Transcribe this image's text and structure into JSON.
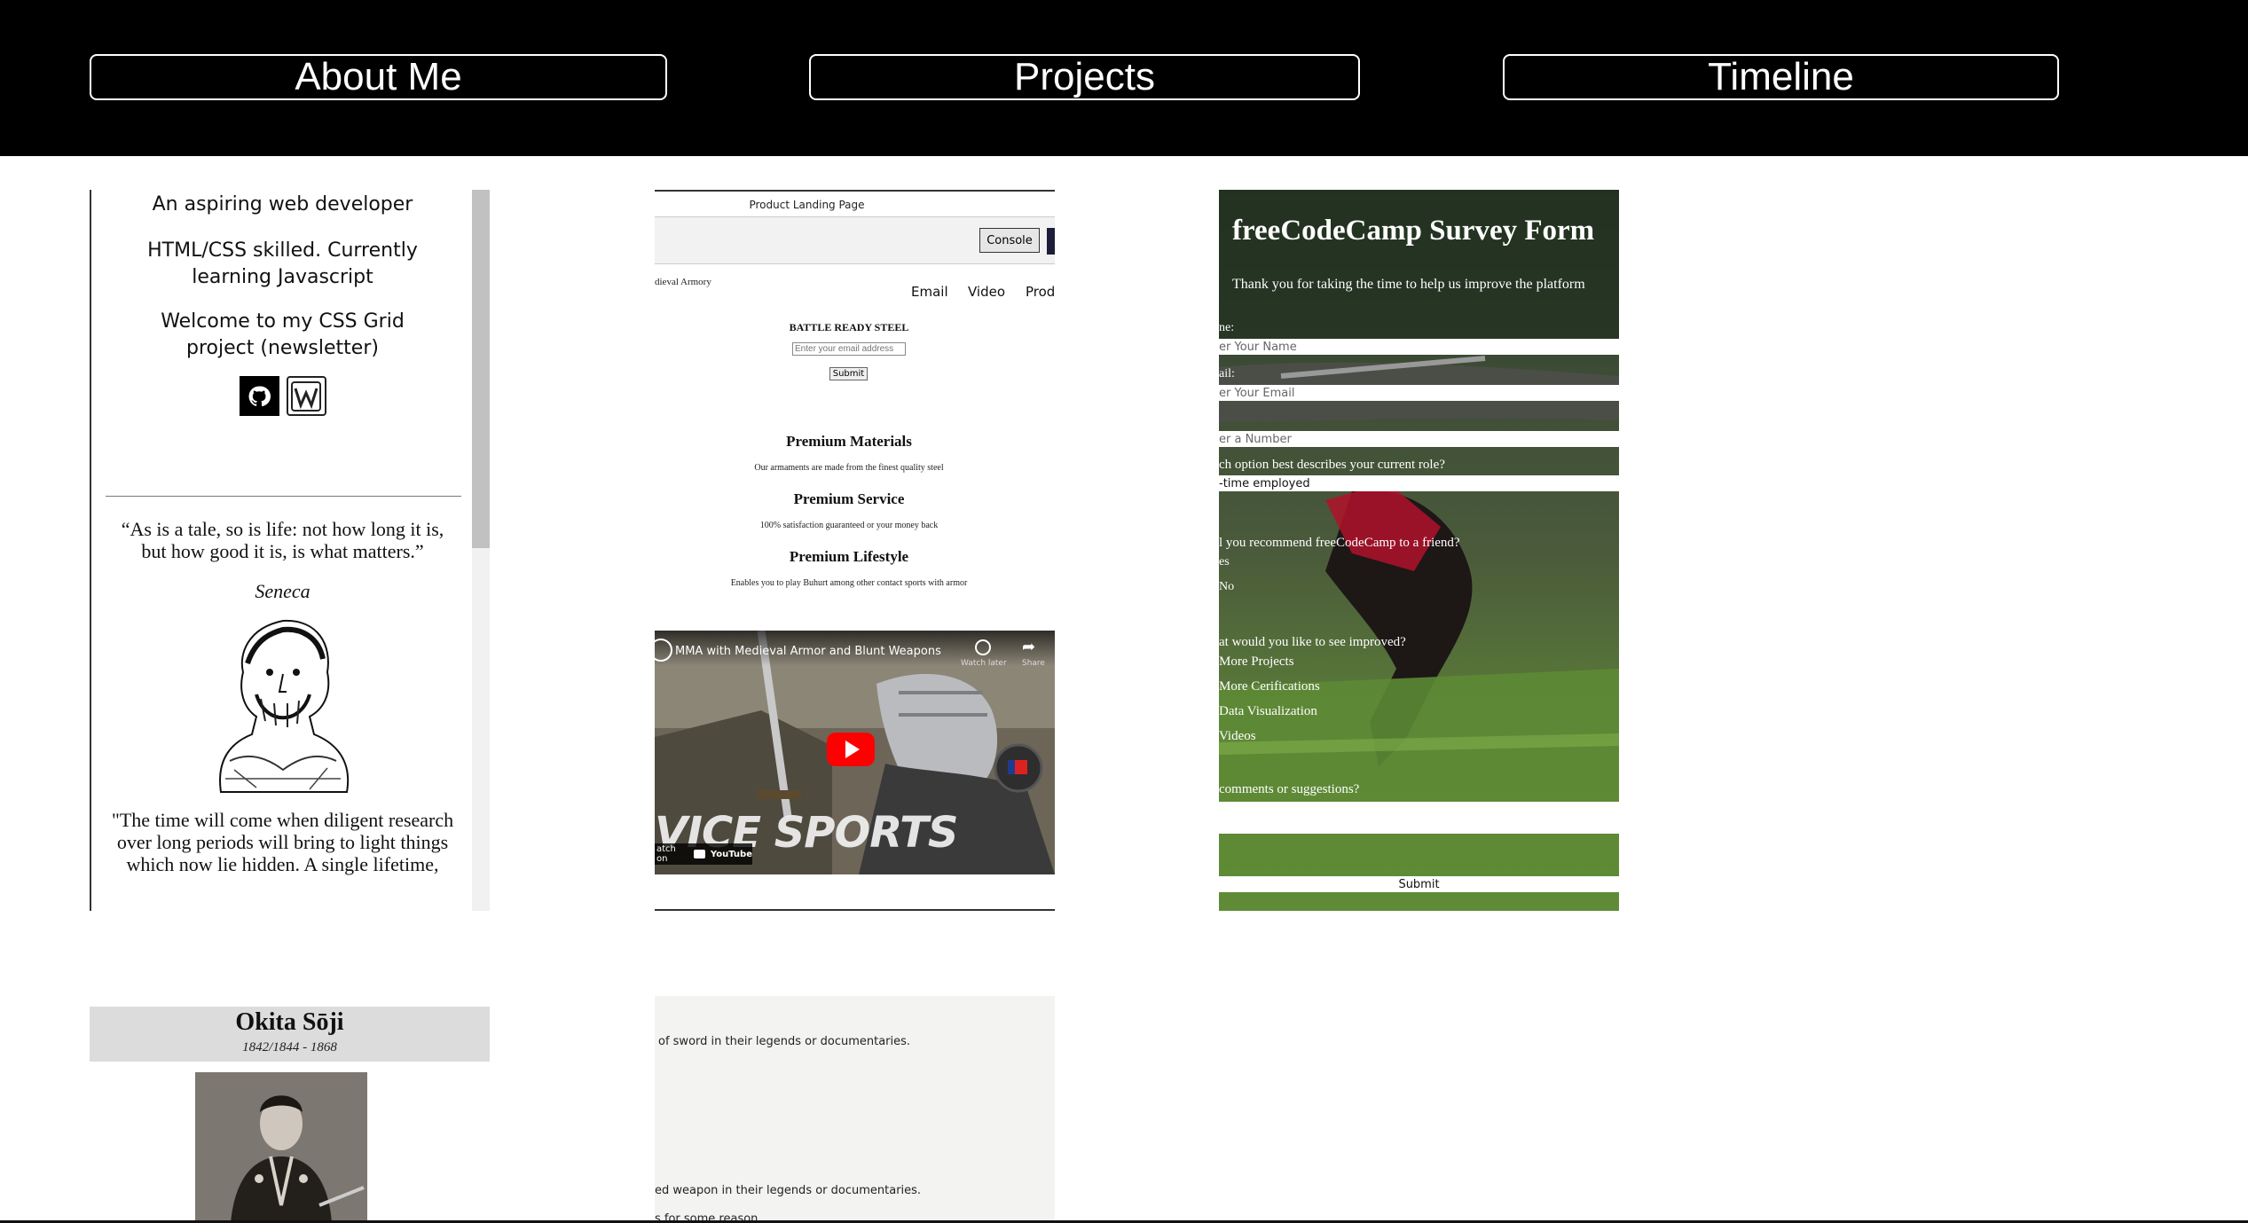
{
  "nav": {
    "about": "About Me",
    "projects": "Projects",
    "timeline": "Timeline"
  },
  "profile": {
    "line1": "An aspiring web developer",
    "line2": "HTML/CSS skilled. Currently learning Javascript",
    "line3": "Welcome to my CSS Grid project (newsletter)",
    "quote1": "“As is a tale, so is life: not how long it is, but how good it is, is what matters.”",
    "author1": "Seneca",
    "quote2": "\"The time will come when diligent research over long periods will bring to light things which now lie hidden. A single lifetime,"
  },
  "landing": {
    "page_title": "Product Landing Page",
    "console_btn": "Console",
    "brand": "dieval Armory",
    "nav_email": "Email",
    "nav_video": "Video",
    "nav_prod": "Prod",
    "hero_title": "BATTLE READY STEEL",
    "email_placeholder": "Enter your email address",
    "submit": "Submit",
    "f1_title": "Premium Materials",
    "f1_text": "Our armaments are made from the finest quality steel",
    "f2_title": "Premium Service",
    "f2_text": "100% satisfaction guaranteed or your money back",
    "f3_title": "Premium Lifestyle",
    "f3_text": "Enables you to play Buhurt among other contact sports with armor",
    "video_title": "MMA with Medieval Armor and Blunt Weapons",
    "video_watch_later": "Watch later",
    "video_share": "Share",
    "video_overlay": "VICE SPORTS",
    "video_watch_on": "atch on",
    "video_youtube": "YouTube"
  },
  "survey": {
    "title": "freeCodeCamp Survey Form",
    "subtitle": "Thank you for taking the time to help us improve the platform",
    "name_label": "ne:",
    "name_placeholder": "er Your Name",
    "email_label": "ail:",
    "email_placeholder": "er Your Email",
    "number_placeholder": "er a Number",
    "role_label": "ch option best describes your current role?",
    "role_value": "-time employed",
    "recommend_label": "l you recommend freeCodeCamp to a friend?",
    "opt_yes": "es",
    "opt_no": "No",
    "improve_label": "at would you like to see improved?",
    "cb1": "More Projects",
    "cb2": "More Cerifications",
    "cb3": "Data Visualization",
    "cb4": "Videos",
    "comments_label": "comments or suggestions?",
    "submit": "Submit"
  },
  "tribute": {
    "name": "Okita Sōji",
    "dates": "1842/1844 - 1868"
  },
  "doc": {
    "line1": "of sword in their legends or documentaries.",
    "line2": "ed weapon in their legends or documentaries.",
    "line3": "s for some reason"
  },
  "colors": {
    "topbar": "#000000",
    "accent_youtube": "#ff0000",
    "survey_field": "#2a3130"
  }
}
